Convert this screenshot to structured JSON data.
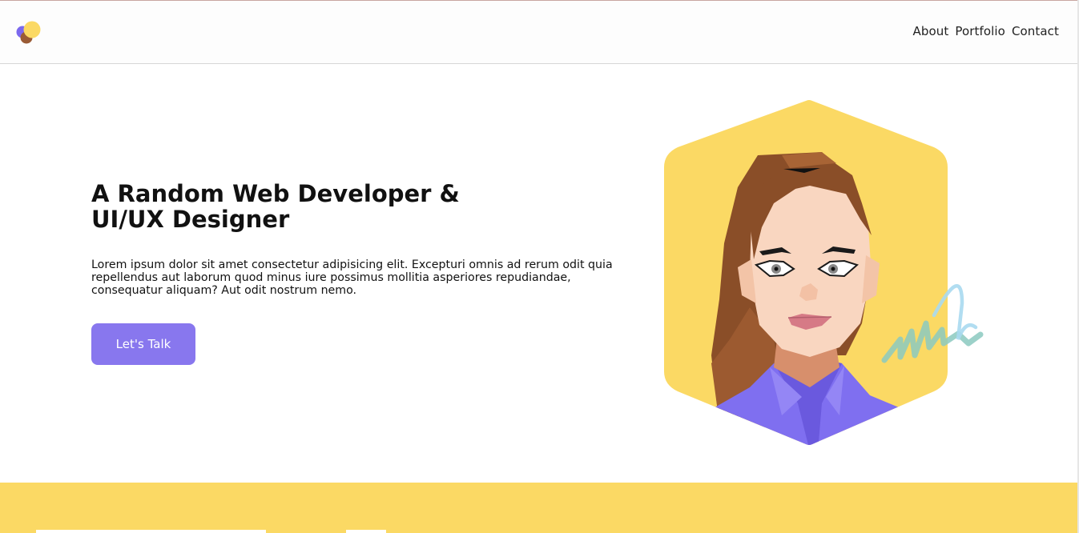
{
  "nav": {
    "links": [
      "About",
      "Portfolio",
      "Contact"
    ]
  },
  "hero": {
    "title_line1": "A Random Web Developer &",
    "title_line2": "UI/UX Designer",
    "description": "Lorem ipsum dolor sit amet consectetur adipisicing elit. Excepturi omnis ad rerum odit quia repellendus aut laborum quod minus iure possimus mollitia asperiores repudiandae, consequatur aliquam? Aut odit nostrum nemo.",
    "cta_label": "Let's Talk"
  },
  "colors": {
    "accent": "#8877ee",
    "brand_yellow": "#fbd964",
    "logo_purple": "#7b68ee",
    "logo_brown": "#9a5b35",
    "logo_yellow": "#fbd964"
  },
  "icons": {
    "logo": "three-circles-logo-icon",
    "portrait": "avatar-portrait-illustration"
  }
}
